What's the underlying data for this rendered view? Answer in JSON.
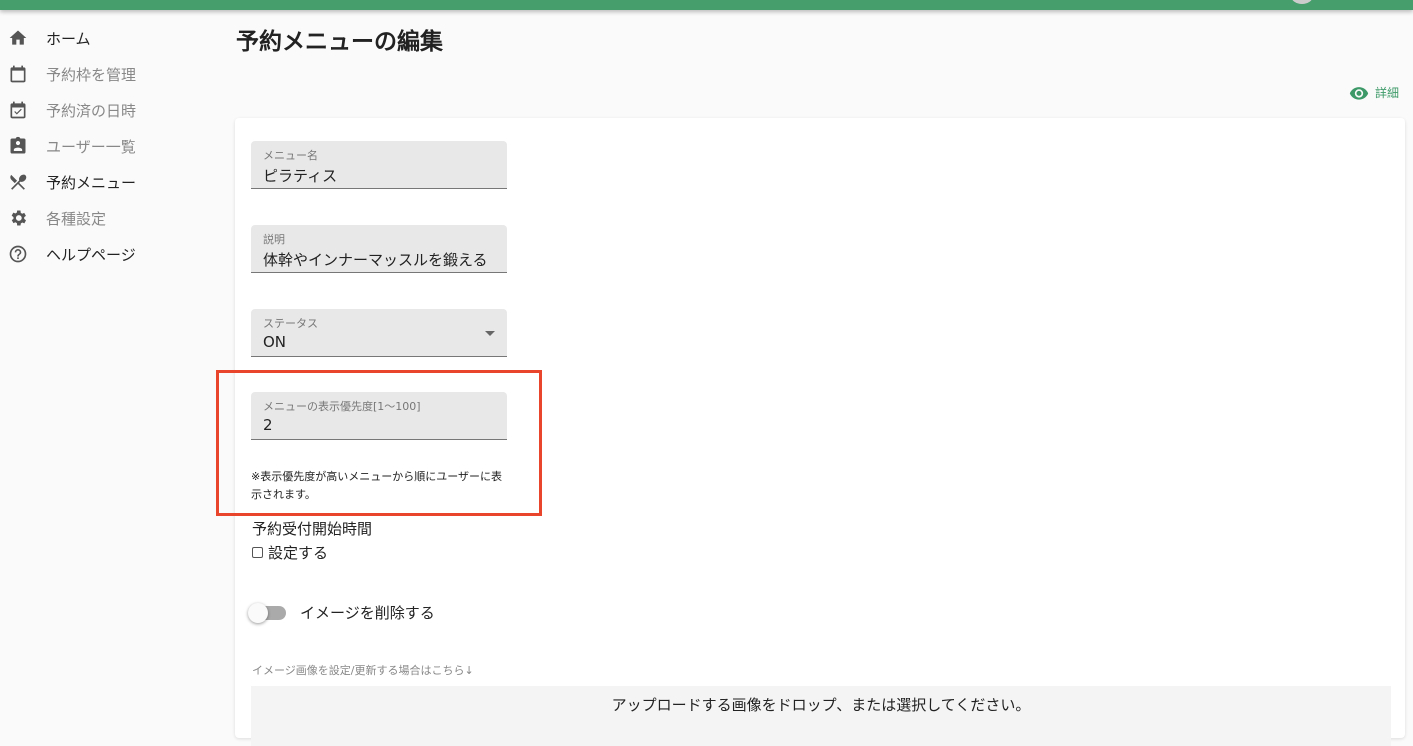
{
  "sidebar": {
    "items": [
      {
        "label": "ホーム",
        "icon": "home-icon"
      },
      {
        "label": "予約枠を管理",
        "icon": "calendar-icon"
      },
      {
        "label": "予約済の日時",
        "icon": "calendar-check-icon"
      },
      {
        "label": "ユーザー一覧",
        "icon": "badge-icon"
      },
      {
        "label": "予約メニュー",
        "icon": "utensils-icon"
      },
      {
        "label": "各種設定",
        "icon": "gear-icon"
      },
      {
        "label": "ヘルプページ",
        "icon": "help-icon"
      }
    ]
  },
  "page": {
    "title": "予約メニューの編集",
    "detail_label": "詳細"
  },
  "form": {
    "name": {
      "label": "メニュー名",
      "value": "ピラティス"
    },
    "description": {
      "label": "説明",
      "value": "体幹やインナーマッスルを鍛える"
    },
    "status": {
      "label": "ステータス",
      "value": "ON"
    },
    "priority": {
      "label": "メニューの表示優先度[1〜100]",
      "value": "2",
      "note": "※表示優先度が高いメニューから順にユーザーに表示されます。"
    },
    "start_time": {
      "heading": "予約受付開始時間",
      "checkbox_label": "設定する",
      "checked": false
    },
    "delete_image": {
      "label": "イメージを削除する",
      "on": false
    },
    "image_hint": "イメージ画像を設定/更新する場合はこちら↓",
    "dropzone": "アップロードする画像をドロップ、または選択してください。"
  },
  "colors": {
    "brand": "#459e6b",
    "highlight": "#e8452c"
  }
}
